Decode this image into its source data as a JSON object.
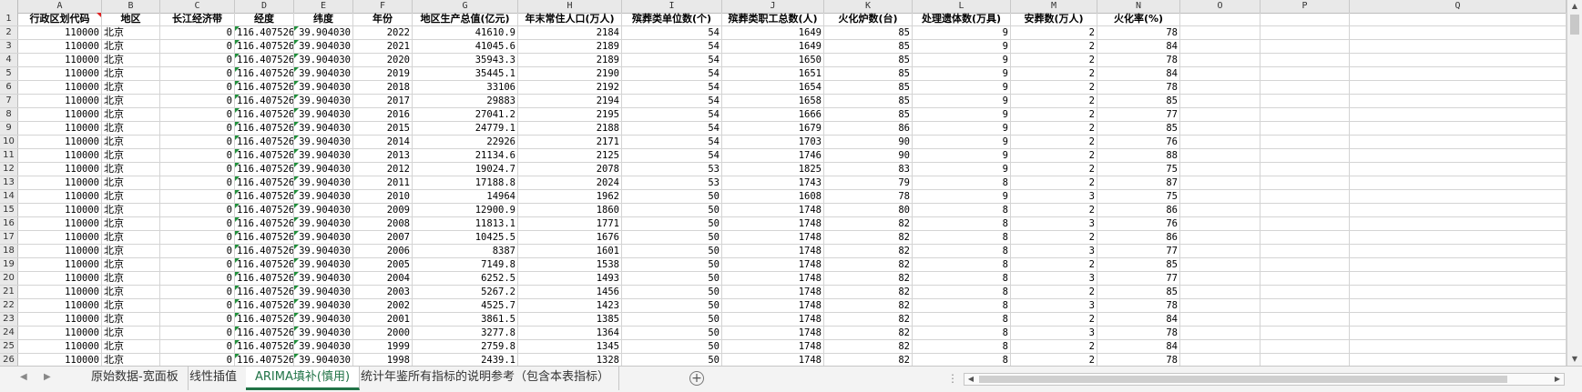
{
  "columns": [
    "A",
    "B",
    "C",
    "D",
    "E",
    "F",
    "G",
    "H",
    "I",
    "J",
    "K",
    "L",
    "M",
    "N",
    "O",
    "P",
    "Q"
  ],
  "header_row": {
    "row_number": "1",
    "cells": [
      "行政区划代码",
      "地区",
      "长江经济带",
      "经度",
      "纬度",
      "年份",
      "地区生产总值(亿元)",
      "年末常住人口(万人)",
      "殡葬类单位数(个)",
      "殡葬类职工总数(人)",
      "火化炉数(台)",
      "处理遗体数(万具)",
      "安葬数(万人)",
      "火化率(%)"
    ]
  },
  "rows": [
    {
      "n": "2",
      "cells": [
        "110000",
        "北京",
        "0",
        "116.407526",
        "39.904030",
        "2022",
        "41610.9",
        "2184",
        "54",
        "1649",
        "85",
        "9",
        "2",
        "78"
      ]
    },
    {
      "n": "3",
      "cells": [
        "110000",
        "北京",
        "0",
        "116.407526",
        "39.904030",
        "2021",
        "41045.6",
        "2189",
        "54",
        "1649",
        "85",
        "9",
        "2",
        "84"
      ]
    },
    {
      "n": "4",
      "cells": [
        "110000",
        "北京",
        "0",
        "116.407526",
        "39.904030",
        "2020",
        "35943.3",
        "2189",
        "54",
        "1650",
        "85",
        "9",
        "2",
        "78"
      ]
    },
    {
      "n": "5",
      "cells": [
        "110000",
        "北京",
        "0",
        "116.407526",
        "39.904030",
        "2019",
        "35445.1",
        "2190",
        "54",
        "1651",
        "85",
        "9",
        "2",
        "84"
      ]
    },
    {
      "n": "6",
      "cells": [
        "110000",
        "北京",
        "0",
        "116.407526",
        "39.904030",
        "2018",
        "33106",
        "2192",
        "54",
        "1654",
        "85",
        "9",
        "2",
        "78"
      ]
    },
    {
      "n": "7",
      "cells": [
        "110000",
        "北京",
        "0",
        "116.407526",
        "39.904030",
        "2017",
        "29883",
        "2194",
        "54",
        "1658",
        "85",
        "9",
        "2",
        "85"
      ]
    },
    {
      "n": "8",
      "cells": [
        "110000",
        "北京",
        "0",
        "116.407526",
        "39.904030",
        "2016",
        "27041.2",
        "2195",
        "54",
        "1666",
        "85",
        "9",
        "2",
        "77"
      ]
    },
    {
      "n": "9",
      "cells": [
        "110000",
        "北京",
        "0",
        "116.407526",
        "39.904030",
        "2015",
        "24779.1",
        "2188",
        "54",
        "1679",
        "86",
        "9",
        "2",
        "85"
      ]
    },
    {
      "n": "10",
      "cells": [
        "110000",
        "北京",
        "0",
        "116.407526",
        "39.904030",
        "2014",
        "22926",
        "2171",
        "54",
        "1703",
        "90",
        "9",
        "2",
        "76"
      ]
    },
    {
      "n": "11",
      "cells": [
        "110000",
        "北京",
        "0",
        "116.407526",
        "39.904030",
        "2013",
        "21134.6",
        "2125",
        "54",
        "1746",
        "90",
        "9",
        "2",
        "88"
      ]
    },
    {
      "n": "12",
      "cells": [
        "110000",
        "北京",
        "0",
        "116.407526",
        "39.904030",
        "2012",
        "19024.7",
        "2078",
        "53",
        "1825",
        "83",
        "9",
        "2",
        "75"
      ]
    },
    {
      "n": "13",
      "cells": [
        "110000",
        "北京",
        "0",
        "116.407526",
        "39.904030",
        "2011",
        "17188.8",
        "2024",
        "53",
        "1743",
        "79",
        "8",
        "2",
        "87"
      ]
    },
    {
      "n": "14",
      "cells": [
        "110000",
        "北京",
        "0",
        "116.407526",
        "39.904030",
        "2010",
        "14964",
        "1962",
        "50",
        "1608",
        "78",
        "9",
        "3",
        "75"
      ]
    },
    {
      "n": "15",
      "cells": [
        "110000",
        "北京",
        "0",
        "116.407526",
        "39.904030",
        "2009",
        "12900.9",
        "1860",
        "50",
        "1748",
        "80",
        "8",
        "2",
        "86"
      ]
    },
    {
      "n": "16",
      "cells": [
        "110000",
        "北京",
        "0",
        "116.407526",
        "39.904030",
        "2008",
        "11813.1",
        "1771",
        "50",
        "1748",
        "82",
        "8",
        "3",
        "76"
      ]
    },
    {
      "n": "17",
      "cells": [
        "110000",
        "北京",
        "0",
        "116.407526",
        "39.904030",
        "2007",
        "10425.5",
        "1676",
        "50",
        "1748",
        "82",
        "8",
        "2",
        "86"
      ]
    },
    {
      "n": "18",
      "cells": [
        "110000",
        "北京",
        "0",
        "116.407526",
        "39.904030",
        "2006",
        "8387",
        "1601",
        "50",
        "1748",
        "82",
        "8",
        "3",
        "77"
      ]
    },
    {
      "n": "19",
      "cells": [
        "110000",
        "北京",
        "0",
        "116.407526",
        "39.904030",
        "2005",
        "7149.8",
        "1538",
        "50",
        "1748",
        "82",
        "8",
        "2",
        "85"
      ]
    },
    {
      "n": "20",
      "cells": [
        "110000",
        "北京",
        "0",
        "116.407526",
        "39.904030",
        "2004",
        "6252.5",
        "1493",
        "50",
        "1748",
        "82",
        "8",
        "3",
        "77"
      ]
    },
    {
      "n": "21",
      "cells": [
        "110000",
        "北京",
        "0",
        "116.407526",
        "39.904030",
        "2003",
        "5267.2",
        "1456",
        "50",
        "1748",
        "82",
        "8",
        "2",
        "85"
      ]
    },
    {
      "n": "22",
      "cells": [
        "110000",
        "北京",
        "0",
        "116.407526",
        "39.904030",
        "2002",
        "4525.7",
        "1423",
        "50",
        "1748",
        "82",
        "8",
        "3",
        "78"
      ]
    },
    {
      "n": "23",
      "cells": [
        "110000",
        "北京",
        "0",
        "116.407526",
        "39.904030",
        "2001",
        "3861.5",
        "1385",
        "50",
        "1748",
        "82",
        "8",
        "2",
        "84"
      ]
    },
    {
      "n": "24",
      "cells": [
        "110000",
        "北京",
        "0",
        "116.407526",
        "39.904030",
        "2000",
        "3277.8",
        "1364",
        "50",
        "1748",
        "82",
        "8",
        "3",
        "78"
      ]
    },
    {
      "n": "25",
      "cells": [
        "110000",
        "北京",
        "0",
        "116.407526",
        "39.904030",
        "1999",
        "2759.8",
        "1345",
        "50",
        "1748",
        "82",
        "8",
        "2",
        "84"
      ]
    },
    {
      "n": "26",
      "cells": [
        "110000",
        "北京",
        "0",
        "116.407526",
        "39.904030",
        "1998",
        "2439.1",
        "1328",
        "50",
        "1748",
        "82",
        "8",
        "2",
        "78"
      ]
    }
  ],
  "sheet_tabs": [
    {
      "label": "原始数据-宽面板",
      "active": false
    },
    {
      "label": "线性插值",
      "active": false
    },
    {
      "label": "ARIMA填补(慎用)",
      "active": true
    },
    {
      "label": "统计年鉴所有指标的说明参考（包含本表指标）",
      "active": false
    }
  ],
  "icons": {
    "prev_sheet": "chevron-left-icon",
    "next_sheet": "chevron-right-icon",
    "add_sheet": "plus-circle-icon",
    "more": "ellipsis-icon"
  },
  "colors": {
    "active_tab": "#217346",
    "green_indicator": "#1f8f3a",
    "comment_indicator": "#dd2222",
    "header_bg": "#e9e9e9"
  }
}
